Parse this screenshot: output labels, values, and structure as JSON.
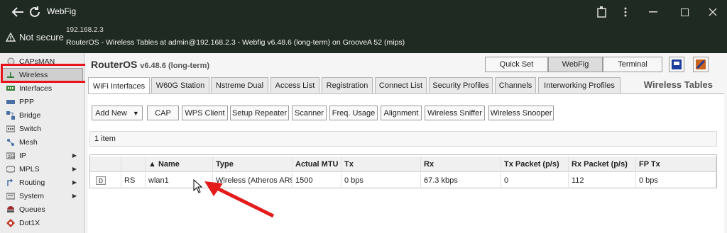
{
  "window": {
    "app_title": "WebFig",
    "icons": [
      "back-arrow-icon",
      "reload-icon",
      "extension-icon",
      "more-vert-icon",
      "minimize-icon",
      "maximize-icon",
      "close-icon"
    ]
  },
  "address": {
    "security_label": "Not secure",
    "host": "192.168.2.3",
    "page_title": "RouterOS - Wireless Tables at admin@192.168.2.3 - Webfig v6.48.6 (long-term) on GrooveA 52 (mips)"
  },
  "sidebar": {
    "items": [
      {
        "label": "CAPsMAN",
        "icon": "capsman-icon",
        "submenu": false
      },
      {
        "label": "Wireless",
        "icon": "wireless-icon",
        "submenu": false,
        "selected": true
      },
      {
        "label": "Interfaces",
        "icon": "interfaces-icon",
        "submenu": false
      },
      {
        "label": "PPP",
        "icon": "ppp-icon",
        "submenu": false
      },
      {
        "label": "Bridge",
        "icon": "bridge-icon",
        "submenu": false
      },
      {
        "label": "Switch",
        "icon": "switch-icon",
        "submenu": false
      },
      {
        "label": "Mesh",
        "icon": "mesh-icon",
        "submenu": false
      },
      {
        "label": "IP",
        "icon": "ip-icon",
        "submenu": true
      },
      {
        "label": "MPLS",
        "icon": "mpls-icon",
        "submenu": true
      },
      {
        "label": "Routing",
        "icon": "routing-icon",
        "submenu": true
      },
      {
        "label": "System",
        "icon": "system-icon",
        "submenu": true
      },
      {
        "label": "Queues",
        "icon": "queues-icon",
        "submenu": false
      },
      {
        "label": "Dot1X",
        "icon": "dot1x-icon",
        "submenu": false
      }
    ]
  },
  "header": {
    "product": "RouterOS",
    "version": "v6.48.6 (long-term)",
    "modes": [
      "Quick Set",
      "WebFig",
      "Terminal"
    ],
    "active_mode": "WebFig"
  },
  "tabs": {
    "items": [
      "WiFi Interfaces",
      "W60G Station",
      "Nstreme Dual",
      "Access List",
      "Registration",
      "Connect List",
      "Security Profiles",
      "Channels",
      "Interworking Profiles"
    ],
    "active": "WiFi Interfaces",
    "section_title": "Wireless Tables"
  },
  "toolbar": {
    "add_new": "Add New",
    "buttons": [
      "CAP",
      "WPS Client",
      "Setup Repeater",
      "Scanner",
      "Freq. Usage",
      "Alignment",
      "Wireless Sniffer",
      "Wireless Snooper"
    ]
  },
  "table": {
    "count": "1 item",
    "headers": [
      "",
      "",
      "▲ Name",
      "Type",
      "Actual MTU",
      "Tx",
      "Rx",
      "Tx Packet (p/s)",
      "Rx Packet (p/s)",
      "FP Tx"
    ],
    "rows": [
      {
        "action": "D",
        "flags": "RS",
        "name": "wlan1",
        "type": "Wireless (Atheros AR9",
        "mtu": "1500",
        "tx": "0 bps",
        "rx": "67.3 kbps",
        "tx_packet": "0",
        "rx_packet": "112",
        "fp_tx": "0 bps"
      }
    ]
  },
  "colors": {
    "chrome": "#1f2a22",
    "highlight": "#e8141a"
  }
}
